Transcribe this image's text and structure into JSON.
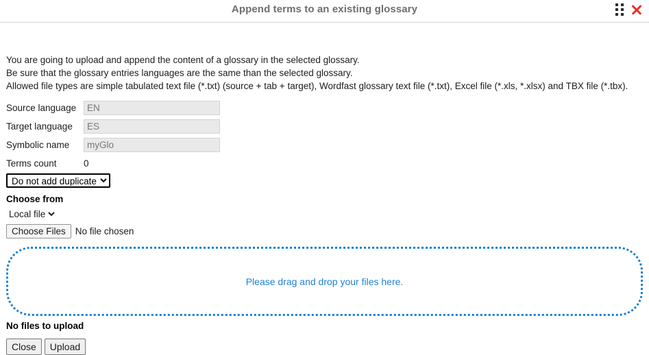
{
  "dialog": {
    "title": "Append terms to an existing glossary",
    "drag_handle_name": "drag-handle",
    "close_label": "×"
  },
  "intro": {
    "line1": "You are going to upload and append the content of a glossary in the selected glossary.",
    "line2": "Be sure that the glossary entries languages are the same than the selected glossary.",
    "line3": "Allowed file types are simple tabulated text file (*.txt) (source + tab + target), Wordfast glossary text file (*.txt), Excel file (*.xls, *.xlsx) and TBX file (*.tbx)."
  },
  "form": {
    "rows": [
      {
        "label": "Source language",
        "value": "EN"
      },
      {
        "label": "Target language",
        "value": "ES"
      },
      {
        "label": "Symbolic name",
        "value": "myGlo"
      }
    ],
    "terms_count_label": "Terms count",
    "terms_count_value": "0",
    "duplicate_select": {
      "selected": "Do not add duplicate",
      "options": [
        "Do not add duplicate"
      ]
    }
  },
  "choose_from": {
    "label": "Choose from",
    "source_select": {
      "selected": "Local file",
      "options": [
        "Local file"
      ]
    },
    "file_input": {
      "button_label": "Choose Files",
      "status": "No file chosen"
    }
  },
  "drop_zone": {
    "text": "Please drag and drop your files here.",
    "border_color": "#1a7fd4",
    "text_color": "#2282d4"
  },
  "upload": {
    "status": "No files to upload",
    "close_label": "Close",
    "upload_label": "Upload"
  }
}
